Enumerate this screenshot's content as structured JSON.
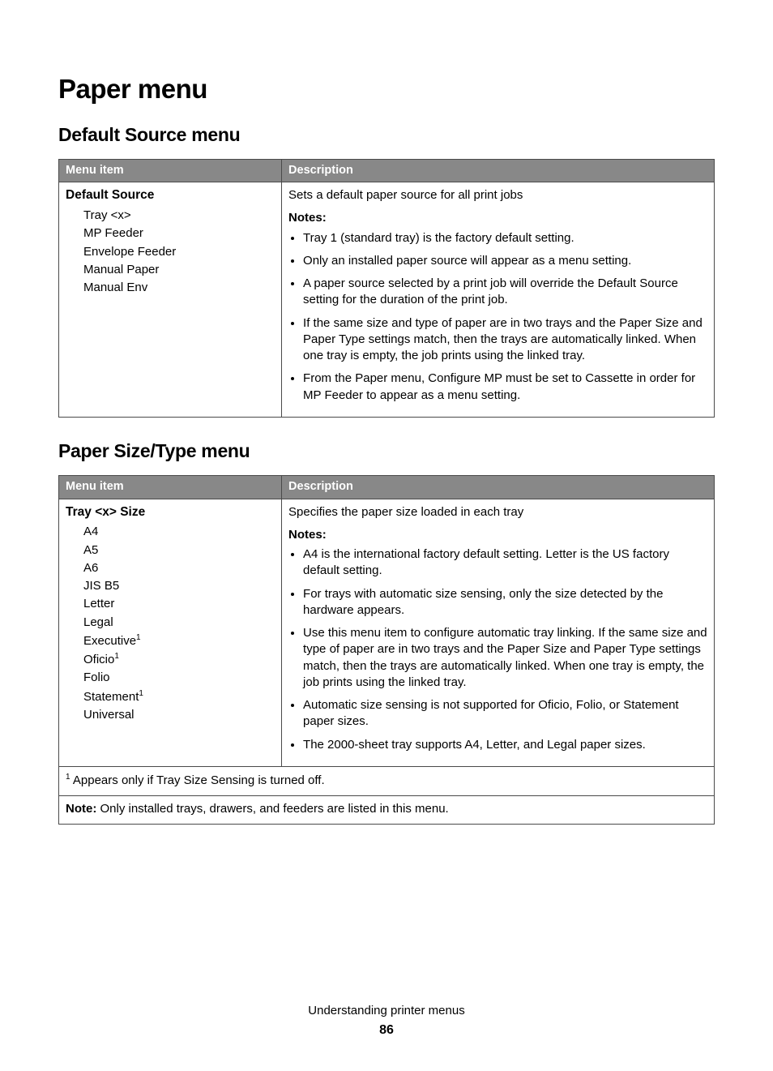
{
  "page": {
    "title": "Paper menu",
    "section1": {
      "heading": "Default Source menu",
      "headers": {
        "menu": "Menu item",
        "desc": "Description"
      },
      "row": {
        "title": "Default Source",
        "options": [
          "Tray <x>",
          "MP Feeder",
          "Envelope Feeder",
          "Manual Paper",
          "Manual Env"
        ],
        "lead": "Sets a default paper source for all print jobs",
        "notesLabel": "Notes:",
        "notes": [
          "Tray 1 (standard tray) is the factory default setting.",
          "Only an installed paper source will appear as a menu setting.",
          "A paper source selected by a print job will override the Default Source setting for the duration of the print job.",
          "If the same size and type of paper are in two trays and the Paper Size and Paper Type settings match, then the trays are automatically linked. When one tray is empty, the job prints using the linked tray.",
          "From the Paper menu, Configure MP must be set to Cassette in order for MP Feeder to appear as a menu setting."
        ]
      }
    },
    "section2": {
      "heading": "Paper Size/Type menu",
      "headers": {
        "menu": "Menu item",
        "desc": "Description"
      },
      "row": {
        "title": "Tray <x> Size",
        "options": [
          {
            "text": "A4",
            "fn": false
          },
          {
            "text": "A5",
            "fn": false
          },
          {
            "text": "A6",
            "fn": false
          },
          {
            "text": "JIS B5",
            "fn": false
          },
          {
            "text": "Letter",
            "fn": false
          },
          {
            "text": "Legal",
            "fn": false
          },
          {
            "text": "Executive",
            "fn": true
          },
          {
            "text": "Oficio",
            "fn": true
          },
          {
            "text": "Folio",
            "fn": false
          },
          {
            "text": "Statement",
            "fn": true
          },
          {
            "text": "Universal",
            "fn": false
          }
        ],
        "lead": "Specifies the paper size loaded in each tray",
        "notesLabel": "Notes:",
        "notes": [
          "A4 is the international factory default setting. Letter is the US factory default setting.",
          "For trays with automatic size sensing, only the size detected by the hardware appears.",
          "Use this menu item to configure automatic tray linking. If the same size and type of paper are in two trays and the Paper Size and Paper Type settings match, then the trays are automatically linked. When one tray is empty, the job prints using the linked tray.",
          "Automatic size sensing is not supported for Oficio, Folio, or Statement paper sizes.",
          "The 2000-sheet tray supports A4, Letter, and Legal paper sizes."
        ]
      },
      "footnote": {
        "marker": "1",
        "text": " Appears only if Tray Size Sensing is turned off."
      },
      "note": {
        "label": "Note:",
        "text": " Only installed trays, drawers, and feeders are listed in this menu."
      }
    },
    "footer": {
      "chapter": "Understanding printer menus",
      "page": "86"
    }
  }
}
